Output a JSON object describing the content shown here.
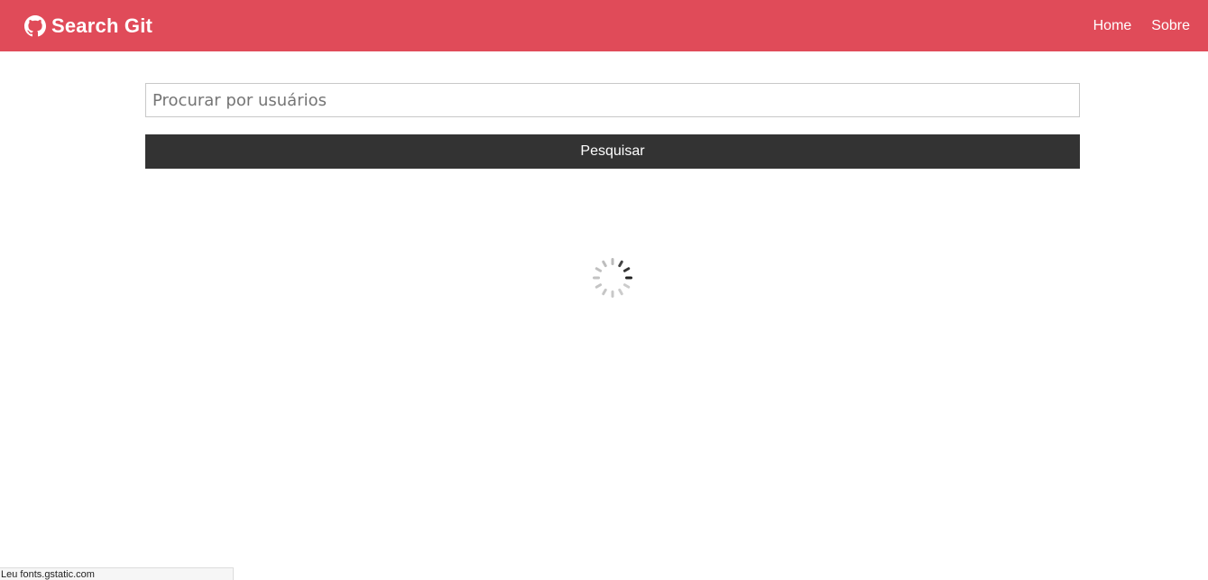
{
  "navbar": {
    "brand": "Search Git",
    "brand_icon": "github-icon",
    "background_color": "#e04b59",
    "links": [
      {
        "label": "Home"
      },
      {
        "label": "Sobre"
      }
    ]
  },
  "search": {
    "value": "",
    "placeholder": "Procurar por usuários",
    "button_label": "Pesquisar"
  },
  "loading": {
    "icon": "spinner-icon"
  },
  "status_bar": {
    "text": "Leu fonts.gstatic.com"
  }
}
